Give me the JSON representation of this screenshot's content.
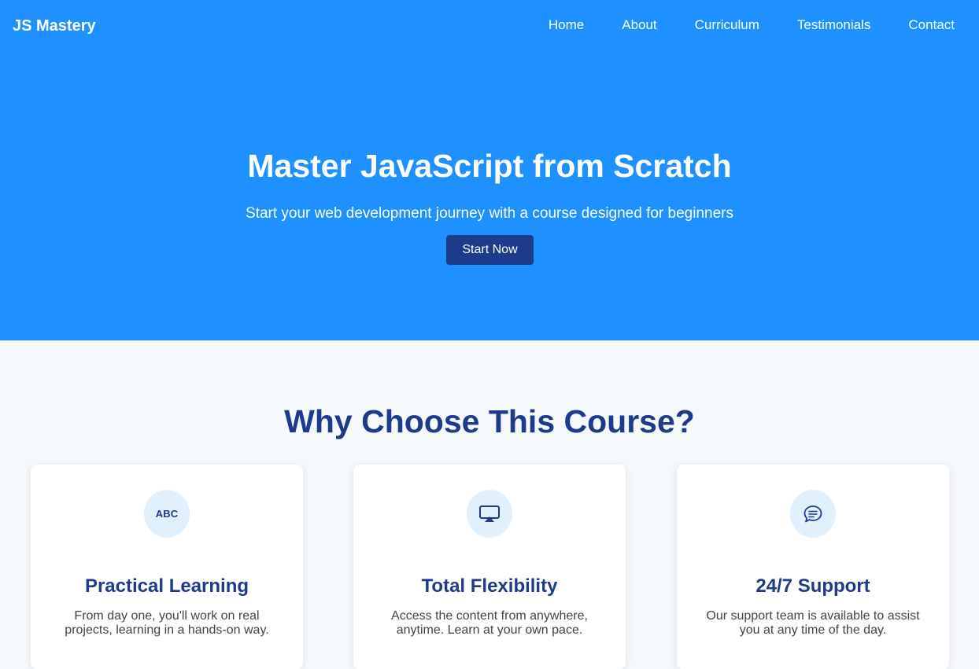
{
  "header": {
    "brand": "JS Mastery",
    "nav": [
      "Home",
      "About",
      "Curriculum",
      "Testimonials",
      "Contact"
    ]
  },
  "hero": {
    "title": "Master JavaScript from Scratch",
    "subtitle": "Start your web development journey with a course designed for beginners",
    "cta_label": "Start Now"
  },
  "features": {
    "title": "Why Choose This Course?",
    "cards": [
      {
        "icon": "abc-icon",
        "icon_text": "ABC",
        "title": "Practical Learning",
        "text": "From day one, you'll work on real projects, learning in a hands-on way."
      },
      {
        "icon": "screen-cast-icon",
        "title": "Total Flexibility",
        "text": "Access the content from anywhere, anytime. Learn at your own pace."
      },
      {
        "icon": "chat-bubble-icon",
        "title": "24/7 Support",
        "text": "Our support team is available to assist you at any time of the day."
      }
    ]
  },
  "colors": {
    "hero_bg": "#1e90ff",
    "accent_dark": "#1e3a8a",
    "icon_bg": "#e0f0fd",
    "page_bg": "#f5f9fc"
  }
}
